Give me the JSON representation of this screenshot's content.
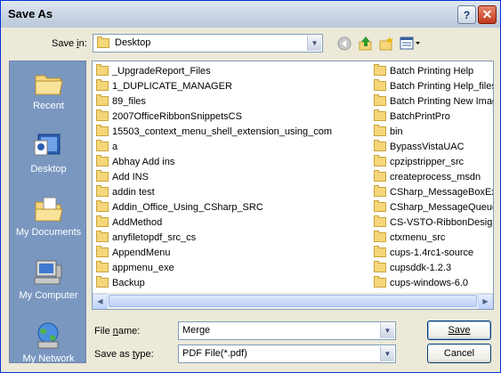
{
  "window": {
    "title": "Save As",
    "help_symbol": "?",
    "close_symbol": "✕"
  },
  "toolbar": {
    "save_in_label": "Save in:",
    "location": "Desktop",
    "icons": [
      "back-icon",
      "up-folder-icon",
      "new-folder-icon",
      "views-menu-icon"
    ]
  },
  "places": [
    {
      "label": "Recent",
      "icon": "recent-icon"
    },
    {
      "label": "Desktop",
      "icon": "desktop-icon"
    },
    {
      "label": "My Documents",
      "icon": "my-documents-icon"
    },
    {
      "label": "My Computer",
      "icon": "my-computer-icon"
    },
    {
      "label": "My Network",
      "icon": "my-network-icon"
    }
  ],
  "files": {
    "column1": [
      "_UpgradeReport_Files",
      "1_DUPLICATE_MANAGER",
      "89_files",
      "2007OfficeRibbonSnippetsCS",
      "15503_context_menu_shell_extension_using_com",
      "a",
      "Abhay Add ins",
      "Add INS",
      "addin test",
      "Addin_Office_Using_CSharp_SRC",
      "AddMethod",
      "anyfiletopdf_src_cs",
      "AppendMenu",
      "appmenu_exe",
      "Backup"
    ],
    "column2": [
      "Batch Printing Help",
      "Batch Printing Help_files",
      "Batch Printing New Imag",
      "BatchPrintPro",
      "bin",
      "BypassVistaUAC",
      "cpzipstripper_src",
      "createprocess_msdn",
      "CSharp_MessageBoxExa",
      "CSharp_MessageQueue",
      "CS-VSTO-RibbonDesigne",
      "ctxmenu_src",
      "cups-1.4rc1-source",
      "cupsddk-1.2.3",
      "cups-windows-6.0"
    ]
  },
  "form": {
    "file_name_label": "File name:",
    "file_name_value": "Merge",
    "save_type_label": "Save as type:",
    "save_type_value": "PDF File(*.pdf)"
  },
  "buttons": {
    "save": "Save",
    "cancel": "Cancel"
  },
  "colors": {
    "places_bar": "#7a97c0",
    "folder": "#f5d67a",
    "title_border": "#0831d9"
  }
}
